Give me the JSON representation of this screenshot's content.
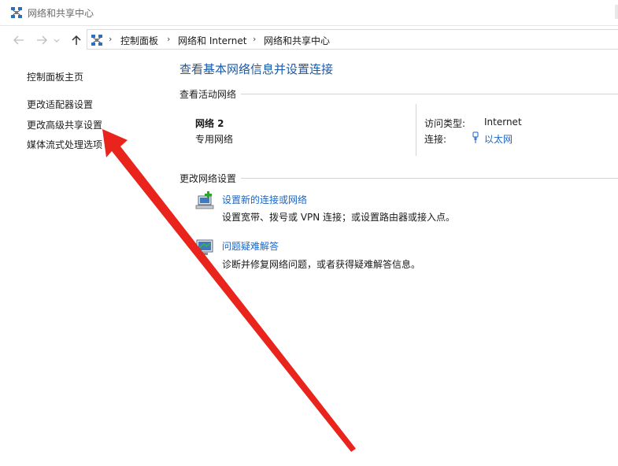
{
  "window": {
    "title": "网络和共享中心"
  },
  "address_bar": {
    "crumbs": [
      "控制面板",
      "网络和 Internet",
      "网络和共享中心"
    ],
    "separator": "›"
  },
  "sidebar": {
    "items": [
      {
        "label": "控制面板主页"
      },
      {
        "label": "更改适配器设置"
      },
      {
        "label": "更改高级共享设置"
      },
      {
        "label": "媒体流式处理选项"
      }
    ]
  },
  "main": {
    "title": "查看基本网络信息并设置连接",
    "active_section": "查看活动网络",
    "network": {
      "name": "网络 2",
      "type": "专用网络",
      "access_type_label": "访问类型:",
      "access_type_value": "Internet",
      "connection_label": "连接:",
      "connection_value": "以太网"
    },
    "change_section": "更改网络设置",
    "tasks": [
      {
        "link": "设置新的连接或网络",
        "desc": "设置宽带、拨号或 VPN 连接；或设置路由器或接入点。"
      },
      {
        "link": "问题疑难解答",
        "desc": "诊断并修复网络问题，或者获得疑难解答信息。"
      }
    ]
  },
  "colors": {
    "title_blue": "#1c5aa5",
    "link_blue": "#1c66c6",
    "annotation_red": "#e8241c"
  }
}
